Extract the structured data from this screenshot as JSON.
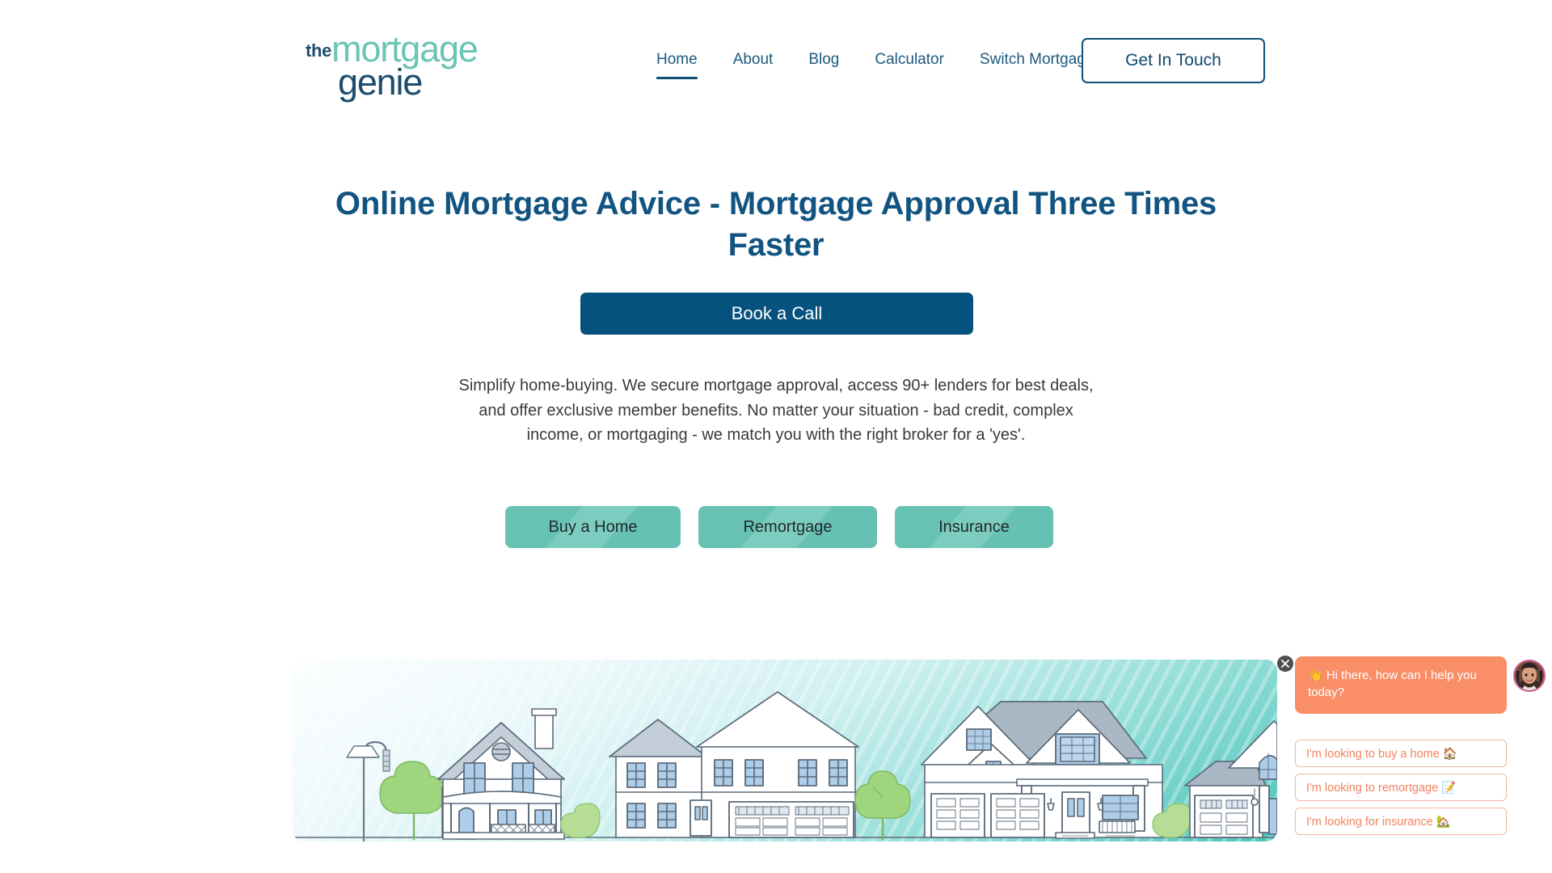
{
  "brand": {
    "logo_the": "the",
    "logo_mortgage": "mortgage",
    "logo_genie": "genie",
    "color_navy": "#1d4d6e",
    "color_teal": "#6bc4b4",
    "color_button_navy": "#06527e",
    "color_pill_teal": "#67c2b3",
    "color_chat_coral": "#f98e67"
  },
  "nav": {
    "items": [
      {
        "label": "Home",
        "active": true
      },
      {
        "label": "About",
        "active": false
      },
      {
        "label": "Blog",
        "active": false
      },
      {
        "label": "Calculator",
        "active": false
      },
      {
        "label": "Switch Mortgage",
        "active": false
      }
    ],
    "cta_label": "Get In Touch"
  },
  "hero": {
    "title": "Online Mortgage Advice - Mortgage Approval Three Times Faster",
    "primary_cta": "Book a Call",
    "subtitle": "Simplify home-buying. We secure mortgage approval, access 90+ lenders for best deals, and offer exclusive member benefits. No matter your situation - bad credit, complex income, or mortgaging - we match you with the right broker for a 'yes'.",
    "pills": [
      {
        "label": "Buy a Home"
      },
      {
        "label": "Remortgage"
      },
      {
        "label": "Insurance"
      }
    ]
  },
  "illustration": {
    "alt": "suburban-houses-line-art",
    "icon": "houses-illustration"
  },
  "chat": {
    "close_icon": "close-icon",
    "avatar_icon": "agent-avatar",
    "greeting": "👋 Hi there, how can I help you today?",
    "quick_replies": [
      {
        "label": "I'm looking to buy a home 🏠"
      },
      {
        "label": "I'm looking to remortgage 📝"
      },
      {
        "label": "I'm looking for insurance 🏡"
      }
    ]
  }
}
